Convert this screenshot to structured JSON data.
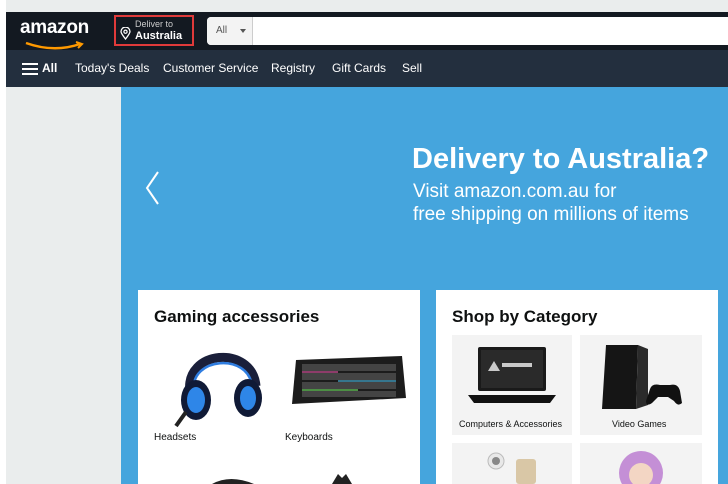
{
  "header": {
    "logo_text": "amazon",
    "deliver_to_label": "Deliver to",
    "deliver_to_country": "Australia",
    "search": {
      "category": "All",
      "placeholder": ""
    }
  },
  "nav": {
    "all_label": "All",
    "items": [
      "Today's Deals",
      "Customer Service",
      "Registry",
      "Gift Cards",
      "Sell"
    ]
  },
  "hero": {
    "title": "Delivery to Australia?",
    "line1": "Visit amazon.com.au for",
    "line2": "free shipping on millions of items"
  },
  "cards": [
    {
      "title": "Gaming accessories",
      "items": [
        "Headsets",
        "Keyboards"
      ]
    },
    {
      "title": "Shop by Category",
      "items": [
        "Computers & Accessories",
        "Video Games"
      ]
    }
  ],
  "colors": {
    "header_bg": "#131921",
    "nav_bg": "#232f3e",
    "hero_bg": "#45a5dd",
    "page_bg": "#eaeded",
    "logo_smile": "#ff9900"
  },
  "icons": [
    "location-pin-icon",
    "hamburger-menu-icon",
    "chevron-left-icon",
    "dropdown-caret-icon"
  ]
}
